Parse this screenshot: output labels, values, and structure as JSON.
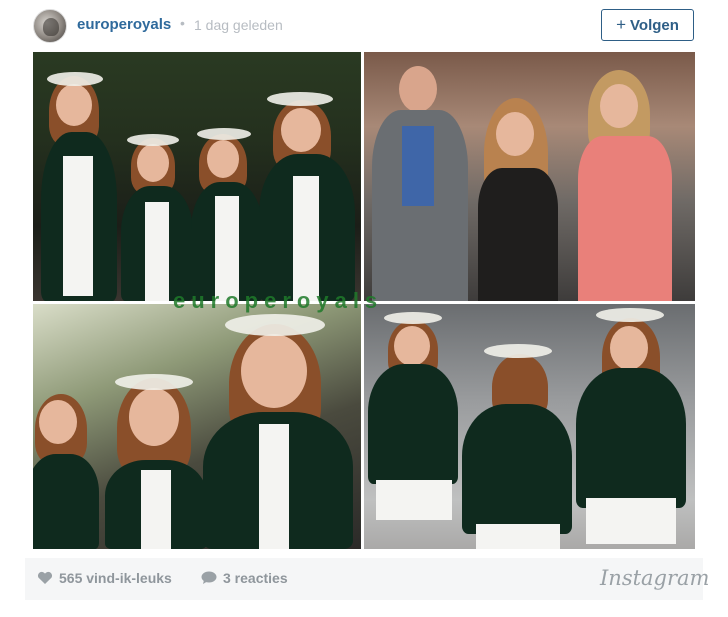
{
  "header": {
    "username": "europeroyals",
    "separator": "•",
    "timestamp": "1 dag geleden",
    "follow_label": "Volgen",
    "follow_icon": "plus-icon",
    "avatar_icon": "avatar-image"
  },
  "collage": {
    "watermark": "europeroyals",
    "photos": [
      "photo-top-left",
      "photo-top-right",
      "photo-bottom-left",
      "photo-bottom-right"
    ]
  },
  "footer": {
    "likes": "565 vind-ik-leuks",
    "likes_icon": "heart-icon",
    "comments": "3 reacties",
    "comments_icon": "comment-icon",
    "brand": "Instagram"
  },
  "colors": {
    "accent": "#2e5e86",
    "username": "#2f6a9c",
    "muted": "#8f969c",
    "footer_bg": "#f5f6f7",
    "watermark": "#1f7a2a"
  }
}
